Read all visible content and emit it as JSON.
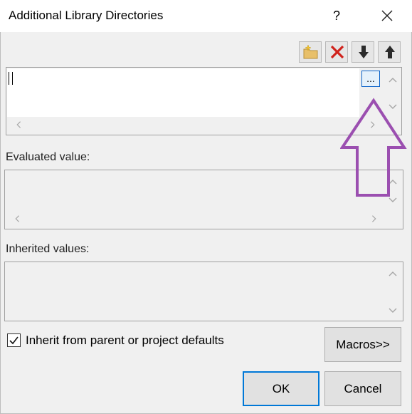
{
  "dialog": {
    "title": "Additional Library Directories",
    "help_glyph": "?",
    "close_icon": "close-icon"
  },
  "toolbar": {
    "buttons": [
      {
        "icon": "new-folder-icon"
      },
      {
        "icon": "delete-icon"
      },
      {
        "icon": "move-down-icon"
      },
      {
        "icon": "move-up-icon"
      }
    ]
  },
  "editor": {
    "ellipsis_label": "...",
    "value": ""
  },
  "evaluated": {
    "label": "Evaluated value:"
  },
  "inherited": {
    "label": "Inherited values:"
  },
  "inherit_checkbox": {
    "label": "Inherit from parent or project defaults",
    "checked": true
  },
  "buttons": {
    "macros": "Macros>>",
    "ok": "OK",
    "cancel": "Cancel"
  },
  "annotation": {
    "color": "#9b4fb0",
    "shape": "up-arrow"
  },
  "colors": {
    "accent": "#0078d7",
    "background": "#f0f0f0"
  }
}
